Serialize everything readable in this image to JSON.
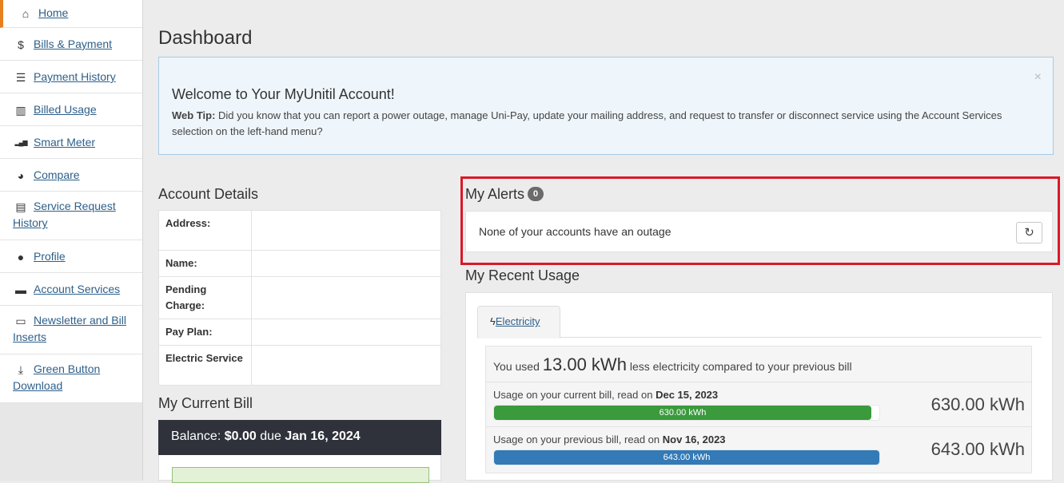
{
  "sidebar": {
    "items": [
      {
        "label": "Home",
        "icon": "home-icon",
        "glyph": "⌂"
      },
      {
        "label": "Bills & Payment",
        "icon": "dollar-icon",
        "glyph": "$"
      },
      {
        "label": "Payment History",
        "icon": "list-icon",
        "glyph": "☰"
      },
      {
        "label": "Billed Usage",
        "icon": "bar-chart-icon",
        "glyph": "▥"
      },
      {
        "label": "Smart Meter",
        "icon": "signal-icon",
        "glyph": "▂▄▆"
      },
      {
        "label": "Compare",
        "icon": "dashboard-gauge-icon",
        "glyph": "◕"
      },
      {
        "label": "Service Request History",
        "icon": "tasks-icon",
        "glyph": "▤"
      },
      {
        "label": "Profile",
        "icon": "user-icon",
        "glyph": "●"
      },
      {
        "label": "Account Services",
        "icon": "file-icon",
        "glyph": "▬"
      },
      {
        "label": "Newsletter and Bill Inserts",
        "icon": "newsletter-icon",
        "glyph": "▭"
      },
      {
        "label": "Green Button Download",
        "icon": "download-icon",
        "glyph": "⤓"
      }
    ]
  },
  "page": {
    "title": "Dashboard"
  },
  "welcome": {
    "heading": "Welcome to Your MyUnitil Account!",
    "tip_label": "Web Tip:",
    "tip_text": "Did you know that you can report a power outage, manage Uni-Pay, update your mailing address, and request to transfer or disconnect service using the Account Services selection on the left-hand menu?",
    "close": "×"
  },
  "account": {
    "heading": "Account Details",
    "rows": [
      {
        "label": "Address:",
        "value": ""
      },
      {
        "label": "Name:",
        "value": ""
      },
      {
        "label": "Pending Charge:",
        "value": ""
      },
      {
        "label": "Pay Plan:",
        "value": ""
      },
      {
        "label": "Electric Service",
        "value": ""
      }
    ]
  },
  "bill": {
    "heading": "My Current Bill",
    "balance_prefix": "Balance:",
    "balance_amount": "$0.00",
    "due_word": "due",
    "due_date": "Jan 16, 2024"
  },
  "alerts": {
    "heading": "My Alerts",
    "count": "0",
    "message": "None of your accounts have an outage",
    "refresh_glyph": "↻"
  },
  "usage": {
    "heading": "My Recent Usage",
    "tab_label": "Electricity",
    "tab_glyph": "ϟ",
    "summary_prefix": "You used",
    "summary_amount": "13.00 kWh",
    "summary_suffix": "less electricity compared to your previous bill",
    "current": {
      "label_prefix": "Usage on your current bill, read on",
      "date": "Dec 15, 2023",
      "bar_label": "630.00 kWh",
      "value": "630.00 kWh",
      "fraction": 0.98
    },
    "previous": {
      "label_prefix": "Usage on your previous bill, read on",
      "date": "Nov 16, 2023",
      "bar_label": "643.00 kWh",
      "value": "643.00 kWh",
      "fraction": 1.0
    },
    "colors": {
      "current": "#3a9a3c",
      "previous": "#337ab7"
    }
  }
}
